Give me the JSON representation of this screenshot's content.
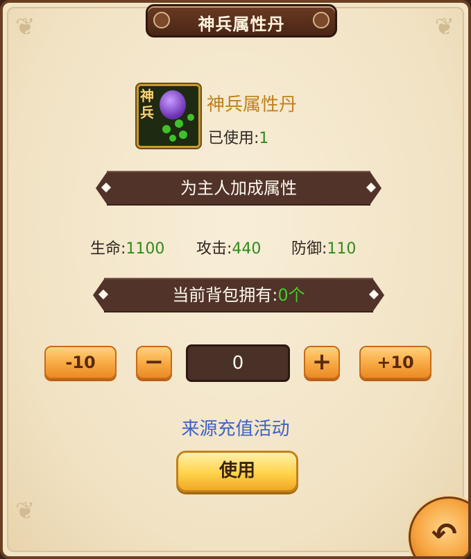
{
  "window": {
    "title": "神兵属性丹"
  },
  "item": {
    "icon_tag": "神兵",
    "name": "神兵属性丹",
    "used_label": "已使用:",
    "used_value": "1"
  },
  "bonus_banner": {
    "label": "为主人加成属性"
  },
  "stats": [
    {
      "label": "生命:",
      "value": "1100"
    },
    {
      "label": "攻击:",
      "value": "440"
    },
    {
      "label": "防御:",
      "value": "110"
    }
  ],
  "inventory_banner": {
    "label": "当前背包拥有:",
    "value": "0个"
  },
  "quantity": {
    "minus10_label": "-10",
    "minus_label": "−",
    "value": "0",
    "plus_label": "+",
    "plus10_label": "+10"
  },
  "source_text": "来源充值活动",
  "use_button": {
    "label": "使用"
  },
  "back_button": {
    "icon": "back-arrow-icon",
    "glyph": "↶"
  },
  "colors": {
    "accent_green": "#2f8a18",
    "link_blue": "#3d60c8",
    "item_name_gold": "#c0801c",
    "panel_bg": "#f2e4c7",
    "banner_dark": "#51332a"
  }
}
